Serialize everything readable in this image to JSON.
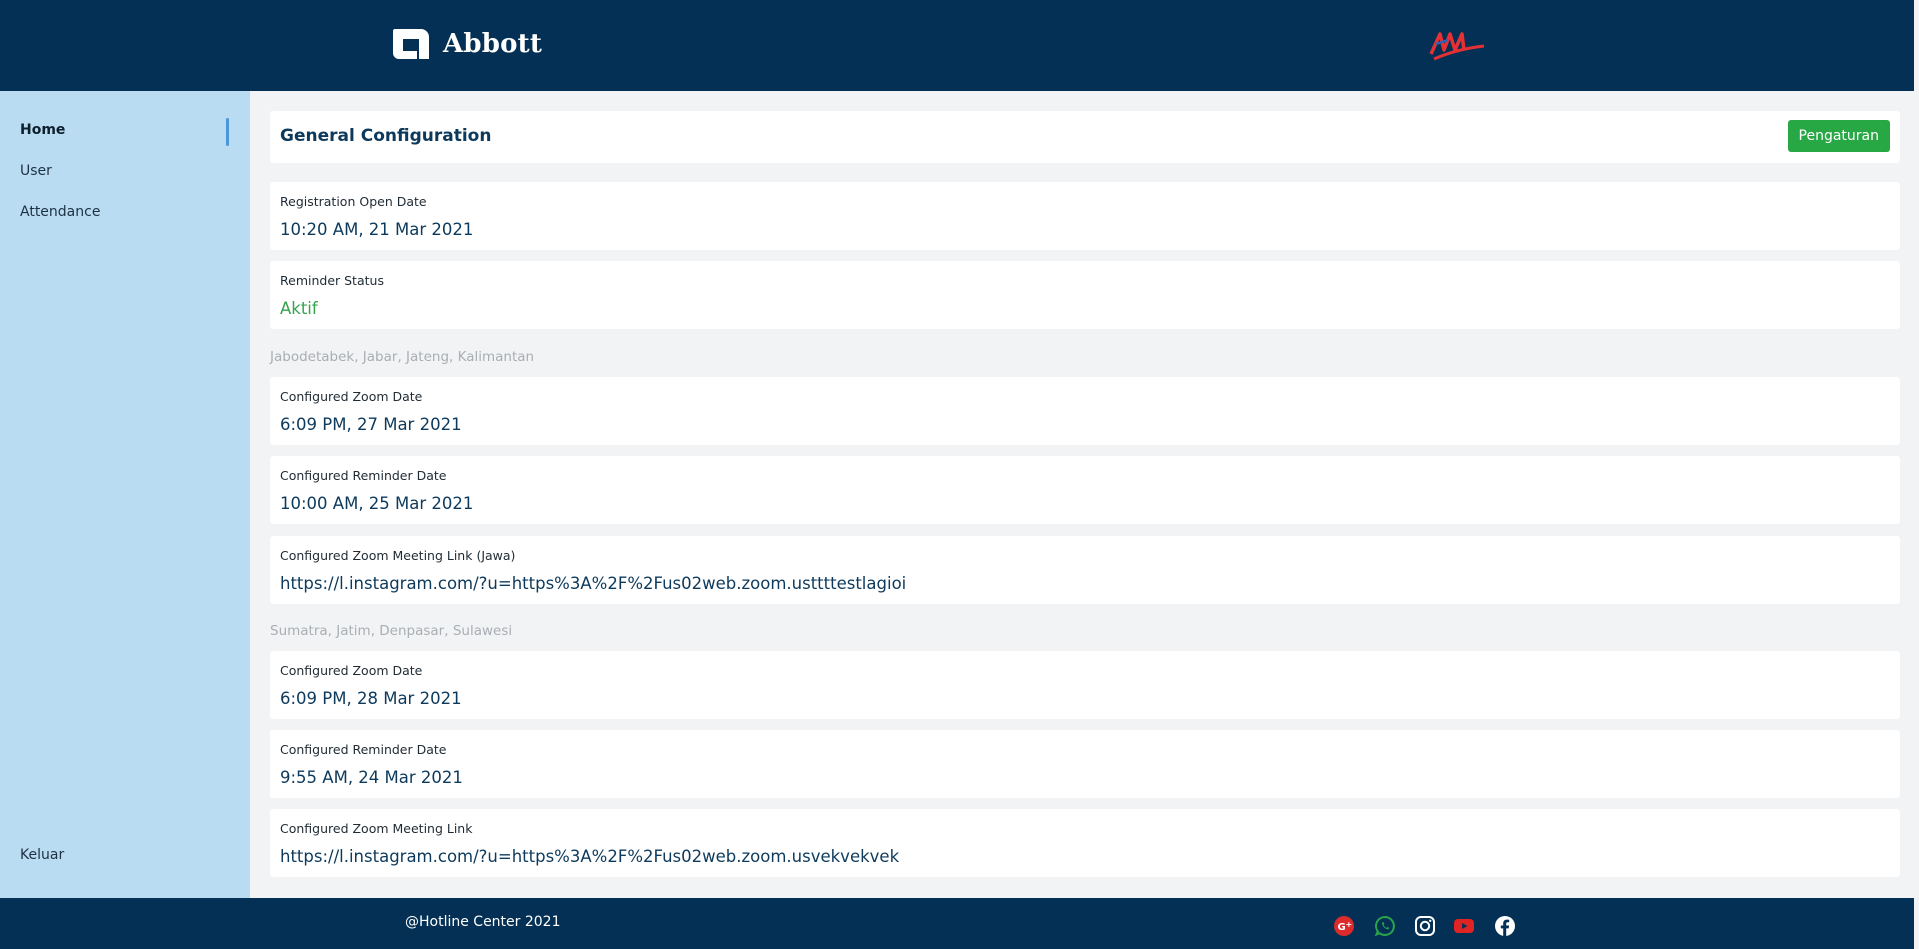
{
  "header": {
    "brand_name": "Abbott",
    "partner_logo": "partner-logo-icon"
  },
  "sidebar": {
    "items": [
      {
        "label": "Home",
        "active": true
      },
      {
        "label": "User",
        "active": false
      },
      {
        "label": "Attendance",
        "active": false
      }
    ],
    "logout_label": "Keluar"
  },
  "main": {
    "title": "General Configuration",
    "settings_button": "Pengaturan",
    "registration": {
      "label": "Registration Open Date",
      "value": "10:20 AM, 21 Mar 2021"
    },
    "reminder_status": {
      "label": "Reminder Status",
      "value": "Aktif",
      "color": "#35a34d"
    },
    "region_1": {
      "title": "Jabodetabek, Jabar, Jateng, Kalimantan",
      "zoom_date": {
        "label": "Configured Zoom Date",
        "value": "6:09 PM, 27 Mar 2021"
      },
      "reminder_date": {
        "label": "Configured Reminder Date",
        "value": "10:00 AM, 25 Mar 2021"
      },
      "zoom_link": {
        "label": "Configured Zoom Meeting Link (Jawa)",
        "value": "https://l.instagram.com/?u=https%3A%2F%2Fus02web.zoom.usttttestlagioi"
      }
    },
    "region_2": {
      "title": "Sumatra, Jatim, Denpasar, Sulawesi",
      "zoom_date": {
        "label": "Configured Zoom Date",
        "value": "6:09 PM, 28 Mar 2021"
      },
      "reminder_date": {
        "label": "Configured Reminder Date",
        "value": "9:55 AM, 24 Mar 2021"
      },
      "zoom_link": {
        "label": "Configured Zoom Meeting Link",
        "value": "https://l.instagram.com/?u=https%3A%2F%2Fus02web.zoom.usvekvekvek"
      }
    }
  },
  "footer": {
    "copyright": "@Hotline Center 2021",
    "social_icons": [
      "google-plus-icon",
      "whatsapp-icon",
      "instagram-icon",
      "youtube-icon",
      "facebook-icon"
    ]
  },
  "colors": {
    "navy": "#033054",
    "sidebar": "#b9dcf3",
    "accent_green": "#28a745",
    "value_blue": "#0d3a5c"
  }
}
